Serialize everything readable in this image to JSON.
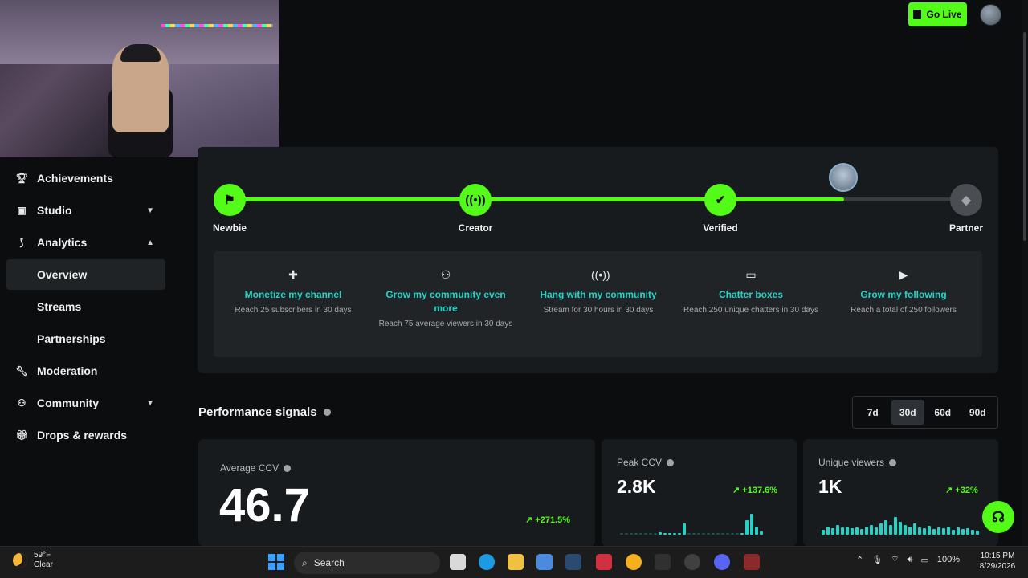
{
  "topbar": {
    "go_live_label": "Go Live"
  },
  "sidebar": {
    "items": [
      {
        "label": "Achievements",
        "icon": "trophy-icon"
      },
      {
        "label": "Studio",
        "icon": "studio-icon"
      },
      {
        "label": "Analytics",
        "icon": "analytics-icon"
      },
      {
        "label": "Overview"
      },
      {
        "label": "Streams"
      },
      {
        "label": "Partnerships"
      },
      {
        "label": "Moderation",
        "icon": "wrench-icon"
      },
      {
        "label": "Community",
        "icon": "community-icon"
      },
      {
        "label": "Drops & rewards",
        "icon": "gift-icon"
      }
    ]
  },
  "progress": {
    "milestones": [
      {
        "label": "Newbie",
        "icon": "flag-icon"
      },
      {
        "label": "Creator",
        "icon": "broadcast-icon"
      },
      {
        "label": "Verified",
        "icon": "check-icon"
      },
      {
        "label": "Partner",
        "icon": "partner-icon"
      }
    ],
    "fill_fraction": 0.835,
    "goals": [
      {
        "title": "Monetize my channel",
        "desc": "Reach 25 subscribers in 30 days",
        "icon": "puzzle-icon"
      },
      {
        "title": "Grow my community even more",
        "desc": "Reach 75 average viewers in 30 days",
        "icon": "people-icon"
      },
      {
        "title": "Hang with my community",
        "desc": "Stream for 30 hours in 30 days",
        "icon": "broadcast-icon"
      },
      {
        "title": "Chatter boxes",
        "desc": "Reach 250 unique chatters in 30 days",
        "icon": "chat-icon"
      },
      {
        "title": "Grow my following",
        "desc": "Reach a total of 250 followers",
        "icon": "play-circle-icon"
      }
    ]
  },
  "performance": {
    "title": "Performance signals",
    "ranges": [
      "7d",
      "30d",
      "60d",
      "90d"
    ],
    "selected_range": "30d",
    "metrics": {
      "avg_ccv": {
        "label": "Average CCV",
        "value": "46.7",
        "delta": "+271.5%"
      },
      "peak_ccv": {
        "label": "Peak CCV",
        "value": "2.8K",
        "delta": "+137.6%"
      },
      "unique_viewers": {
        "label": "Unique viewers",
        "value": "1K",
        "delta": "+32%"
      }
    }
  },
  "taskbar": {
    "weather_temp": "59°F",
    "weather_desc": "Clear",
    "search_label": "Search",
    "battery": "100%",
    "time": "10:15 PM",
    "date": "8/29/2026"
  },
  "colors": {
    "accent": "#53fc18",
    "teal": "#24d3c6",
    "bg": "#0b0d0e",
    "card": "#181b1d"
  }
}
